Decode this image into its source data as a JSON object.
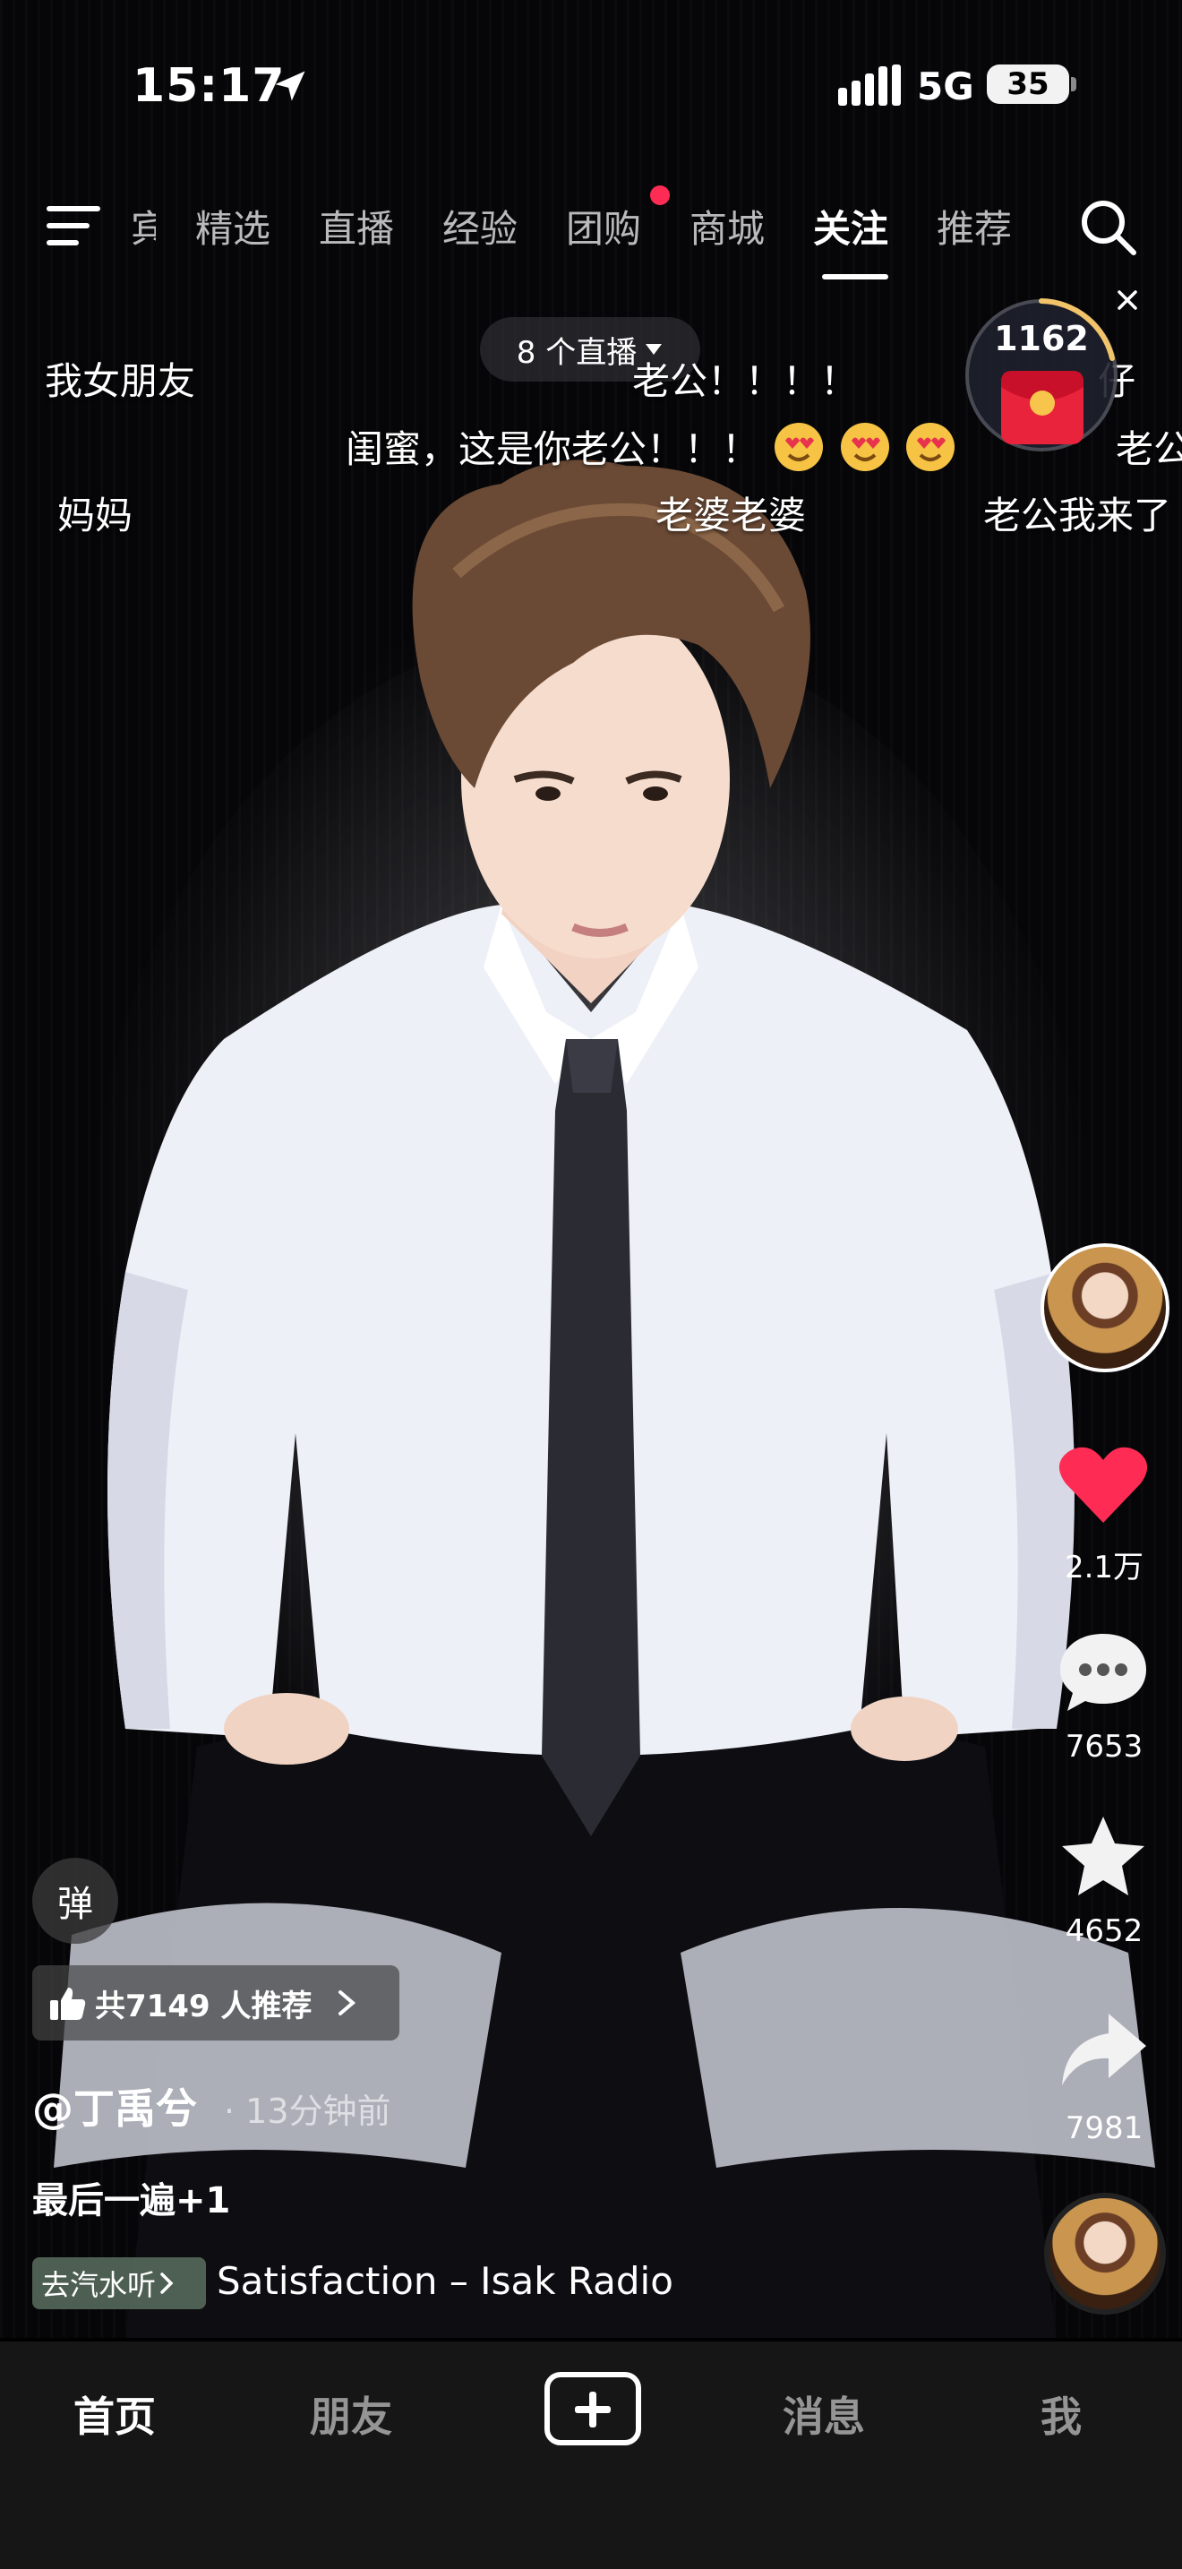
{
  "status_bar": {
    "time": "15:17",
    "network": "5G",
    "battery": "35"
  },
  "top_nav": {
    "tabs": [
      {
        "label": "宾"
      },
      {
        "label": "精选"
      },
      {
        "label": "直播"
      },
      {
        "label": "经验"
      },
      {
        "label": "团购"
      },
      {
        "label": "商城"
      },
      {
        "label": "关注"
      },
      {
        "label": "推荐"
      }
    ],
    "active_tab": "关注"
  },
  "live_pill": {
    "label": "8 个直播"
  },
  "coin_widget": {
    "count": "1162"
  },
  "danmaku": [
    "我女朋友",
    "老公！！！！",
    "仔",
    "闺蜜，这是你老公！！！",
    "老公",
    "妈妈",
    "老婆老婆",
    "老公我来了"
  ],
  "actions": {
    "likes": "2.1万",
    "comments": "7653",
    "favorites": "4652",
    "shares": "7981"
  },
  "video_info": {
    "danmu_toggle": "弹",
    "recommend": "共7149 人推荐",
    "author": "@丁禹兮",
    "time_ago": "· 13分钟前",
    "caption": "最后一遍+1",
    "music_chip": "去汽水听",
    "music_title": "Satisfaction – Isak Radio"
  },
  "bottom_nav": {
    "home": "首页",
    "friends": "朋友",
    "messages": "消息",
    "me": "我"
  },
  "colors": {
    "accent": "#fe2c55",
    "nav_bg": "#161616"
  }
}
